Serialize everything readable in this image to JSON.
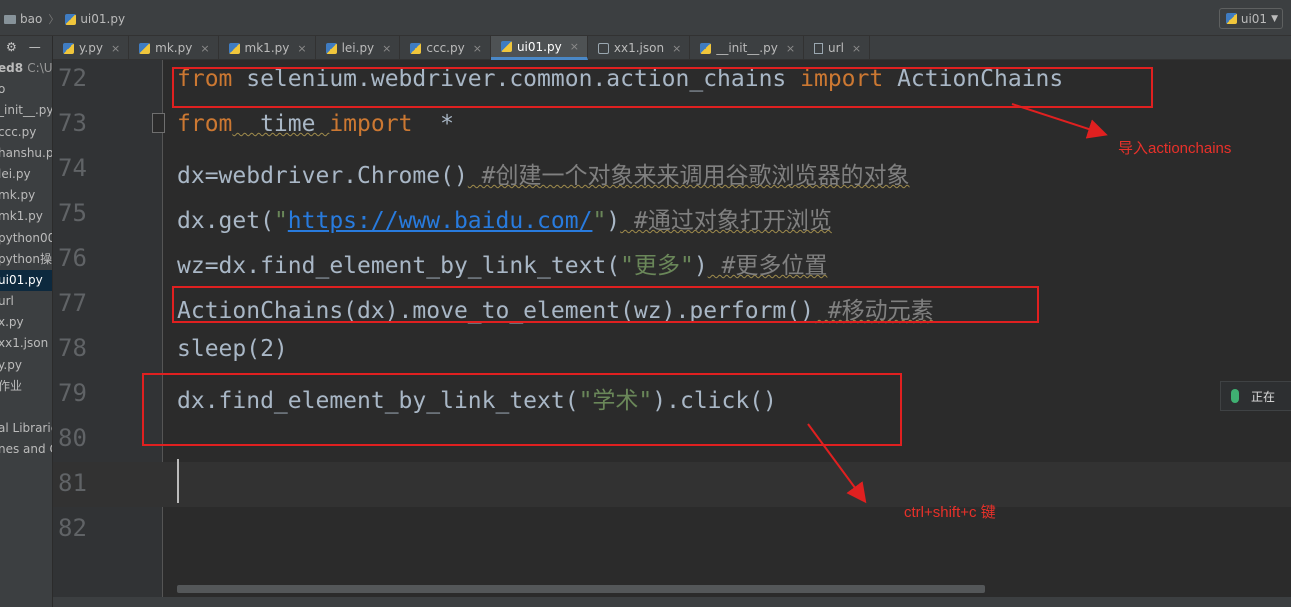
{
  "breadcrumb": {
    "folder": "bao",
    "file": "ui01.py"
  },
  "run_config": {
    "label": "ui01"
  },
  "project_panel": {
    "items": [
      {
        "label": "ed8",
        "extra": "C:\\Us"
      },
      {
        "label": "o"
      },
      {
        "label": "_init__.py"
      },
      {
        "label": "ccc.py"
      },
      {
        "label": "hanshu.py"
      },
      {
        "label": "lei.py"
      },
      {
        "label": "mk.py"
      },
      {
        "label": "mk1.py"
      },
      {
        "label": "python00"
      },
      {
        "label": "python操"
      },
      {
        "label": "ui01.py"
      },
      {
        "label": "url"
      },
      {
        "label": "x.py"
      },
      {
        "label": "xx1.json"
      },
      {
        "label": "y.py"
      },
      {
        "label": "作业"
      },
      {
        "label": ""
      },
      {
        "label": "al Librarie"
      },
      {
        "label": "nes and C"
      }
    ]
  },
  "tabs": [
    {
      "label": "y.py",
      "icon": "python-file-icon"
    },
    {
      "label": "mk.py",
      "icon": "python-file-icon"
    },
    {
      "label": "mk1.py",
      "icon": "python-file-icon"
    },
    {
      "label": "lei.py",
      "icon": "python-file-icon"
    },
    {
      "label": "ccc.py",
      "icon": "python-file-icon"
    },
    {
      "label": "ui01.py",
      "icon": "python-file-icon",
      "active": true
    },
    {
      "label": "xx1.json",
      "icon": "json-file-icon"
    },
    {
      "label": "__init__.py",
      "icon": "python-file-icon"
    },
    {
      "label": "url",
      "icon": "text-file-icon"
    }
  ],
  "editor": {
    "line_numbers": [
      "72",
      "73",
      "74",
      "75",
      "76",
      "77",
      "78",
      "79",
      "80",
      "81",
      "82"
    ],
    "lines": {
      "l72": {
        "kw1": "from",
        "mod": " selenium.webdriver.common.action_chains ",
        "kw2": "import",
        "name": " ActionChains"
      },
      "l73": {
        "kw1": "from",
        "mod": "  time ",
        "kw2": "import",
        "name": "  *"
      },
      "l74": {
        "code": "dx=webdriver.Chrome()",
        "comment": " #创建一个对象来来调用谷歌浏览器的对象"
      },
      "l75": {
        "pre": "dx.get(",
        "q1": "\"",
        "url": "https://www.baidu.com/",
        "q2": "\"",
        "post": ")",
        "comment": " #通过对象打开浏览"
      },
      "l76": {
        "pre": "wz=dx.find_element_by_link_text(",
        "str": "\"更多\"",
        "post": ")",
        "comment": " #更多位置"
      },
      "l77": {
        "code": "ActionChains(dx).move_to_element(wz).perform()",
        "comment": " #移动元素"
      },
      "l78": {
        "code": "sleep(2)"
      },
      "l79": {
        "pre": "dx.find_element_by_link_text(",
        "str": "\"学术\"",
        "post": ").click()"
      }
    }
  },
  "annotations": {
    "import_note": "导入actionchains",
    "shortcut_note": "ctrl+shift+c 键"
  },
  "voice_overlay": {
    "label": "正在"
  },
  "colors": {
    "annotation_red": "#e02020",
    "keyword": "#cc7832",
    "string": "#6a8759",
    "comment": "#808080",
    "link": "#287bde"
  }
}
